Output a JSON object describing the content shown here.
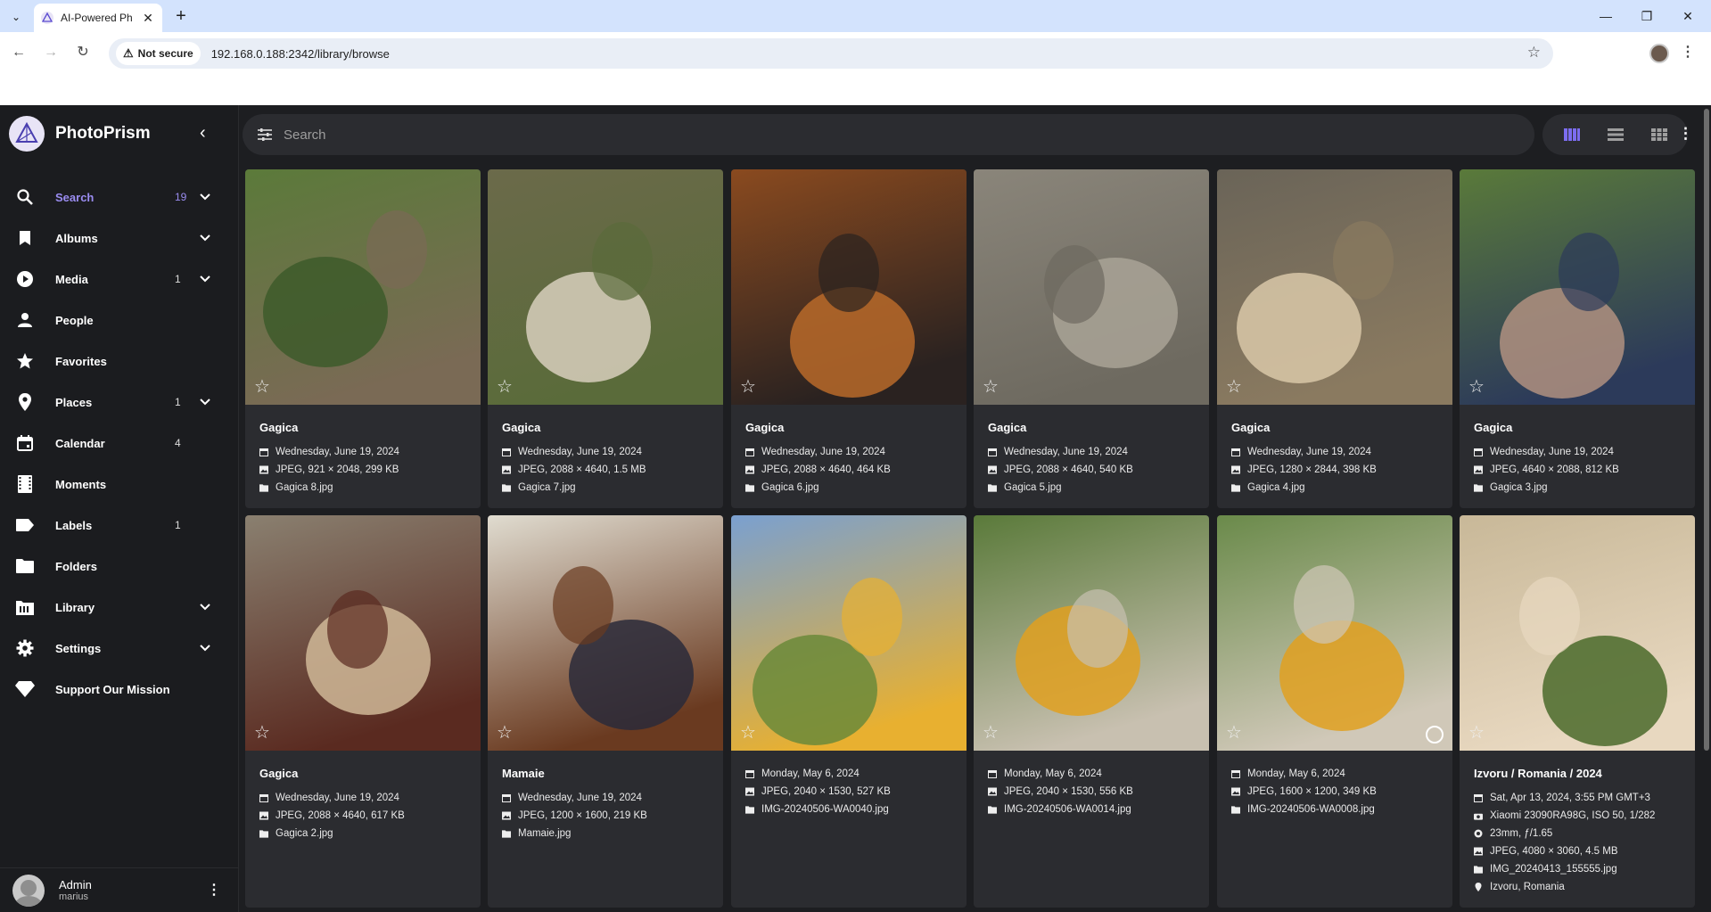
{
  "browser": {
    "tab_title": "AI-Powered Ph",
    "not_secure": "Not secure",
    "url": "192.168.0.188:2342/library/browse"
  },
  "sidebar": {
    "brand": "PhotoPrism",
    "items": [
      {
        "label": "Search",
        "count": "19",
        "expandable": true,
        "icon": "search-icon",
        "active": true
      },
      {
        "label": "Albums",
        "count": "",
        "expandable": true,
        "icon": "bookmark-icon"
      },
      {
        "label": "Media",
        "count": "1",
        "expandable": true,
        "icon": "play-circle-icon"
      },
      {
        "label": "People",
        "count": "",
        "expandable": false,
        "icon": "person-icon"
      },
      {
        "label": "Favorites",
        "count": "",
        "expandable": false,
        "icon": "star-icon"
      },
      {
        "label": "Places",
        "count": "1",
        "expandable": true,
        "icon": "map-pin-icon"
      },
      {
        "label": "Calendar",
        "count": "4",
        "expandable": false,
        "icon": "calendar-icon"
      },
      {
        "label": "Moments",
        "count": "",
        "expandable": false,
        "icon": "film-icon"
      },
      {
        "label": "Labels",
        "count": "1",
        "expandable": false,
        "icon": "label-icon"
      },
      {
        "label": "Folders",
        "count": "",
        "expandable": false,
        "icon": "folder-icon"
      },
      {
        "label": "Library",
        "count": "",
        "expandable": true,
        "icon": "library-icon"
      },
      {
        "label": "Settings",
        "count": "",
        "expandable": true,
        "icon": "gear-icon"
      },
      {
        "label": "Support Our Mission",
        "count": "",
        "expandable": false,
        "icon": "diamond-icon"
      }
    ],
    "user": {
      "name": "Admin",
      "login": "marius"
    }
  },
  "search": {
    "placeholder": "Search"
  },
  "accent": "#7c6df0",
  "photos": [
    {
      "title": "Gagica",
      "date": "Wednesday, June 19, 2024",
      "file_info": "JPEG, 921 × 2048, 299 KB",
      "filename": "Gagica 8.jpg",
      "colors": [
        "#5b7a3a",
        "#3d5a2a",
        "#7a6a55"
      ]
    },
    {
      "title": "Gagica",
      "date": "Wednesday, June 19, 2024",
      "file_info": "JPEG, 2088 × 4640, 1.5 MB",
      "filename": "Gagica 7.jpg",
      "colors": [
        "#6b6a4a",
        "#d8cfbd",
        "#5a6b3a"
      ]
    },
    {
      "title": "Gagica",
      "date": "Wednesday, June 19, 2024",
      "file_info": "JPEG, 2088 × 4640, 464 KB",
      "filename": "Gagica 6.jpg",
      "colors": [
        "#8a4a1f",
        "#b86a2a",
        "#2a2220"
      ]
    },
    {
      "title": "Gagica",
      "date": "Wednesday, June 19, 2024",
      "file_info": "JPEG, 2088 × 4640, 540 KB",
      "filename": "Gagica 5.jpg",
      "colors": [
        "#8a857a",
        "#a9a396",
        "#6e6a60"
      ]
    },
    {
      "title": "Gagica",
      "date": "Wednesday, June 19, 2024",
      "file_info": "JPEG, 1280 × 2844, 398 KB",
      "filename": "Gagica 4.jpg",
      "colors": [
        "#6a6458",
        "#d9c8a8",
        "#8a7a60"
      ]
    },
    {
      "title": "Gagica",
      "date": "Wednesday, June 19, 2024",
      "file_info": "JPEG, 4640 × 2088, 812 KB",
      "filename": "Gagica 3.jpg",
      "colors": [
        "#5a7a3a",
        "#b09080",
        "#2c3a5a"
      ]
    },
    {
      "title": "Gagica",
      "date": "Wednesday, June 19, 2024",
      "file_info": "JPEG, 2088 × 4640, 617 KB",
      "filename": "Gagica 2.jpg",
      "colors": [
        "#8a8070",
        "#d0b898",
        "#5a2a20"
      ]
    },
    {
      "title": "Mamaie",
      "date": "Wednesday, June 19, 2024",
      "file_info": "JPEG, 1200 × 1600, 219 KB",
      "filename": "Mamaie.jpg",
      "colors": [
        "#e0dcd0",
        "#2a2a3a",
        "#6a3a20"
      ]
    },
    {
      "title": "",
      "date": "Monday, May 6, 2024",
      "file_info": "JPEG, 2040 × 1530, 527 KB",
      "filename": "IMG-20240506-WA0040.jpg",
      "colors": [
        "#7aa0d0",
        "#6a8a3a",
        "#e8b030"
      ]
    },
    {
      "title": "",
      "date": "Monday, May 6, 2024",
      "file_info": "JPEG, 2040 × 1530, 556 KB",
      "filename": "IMG-20240506-WA0014.jpg",
      "colors": [
        "#5a7a3a",
        "#e0a020",
        "#c8c0b0"
      ]
    },
    {
      "title": "",
      "date": "Monday, May 6, 2024",
      "file_info": "JPEG, 1600 × 1200, 349 KB",
      "filename": "IMG-20240506-WA0008.jpg",
      "colors": [
        "#6a8a4a",
        "#e0a020",
        "#d0c8b8"
      ]
    },
    {
      "title": "Izvoru / Romania / 2024",
      "date": "Sat, Apr 13, 2024, 3:55 PM GMT+3",
      "camera": "Xiaomi 23090RA98G, ISO 50, 1/282",
      "lens": "23mm, ƒ/1.65",
      "file_info": "JPEG, 4080 × 3060, 4.5 MB",
      "filename": "IMG_20240413_155555.jpg",
      "location": "Izvoru, Romania",
      "colors": [
        "#c8b898",
        "#4a6a2a",
        "#e8d8c0"
      ]
    }
  ]
}
